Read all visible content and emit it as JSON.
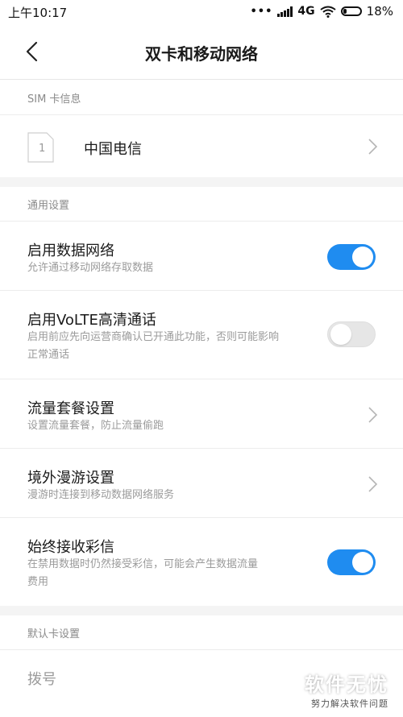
{
  "status_bar": {
    "time": "上午10:17",
    "dots": "•••",
    "network": "4G",
    "battery": "18%"
  },
  "header": {
    "title": "双卡和移动网络",
    "back_icon": "chevron-left-icon"
  },
  "sim_section": {
    "header": "SIM 卡信息",
    "sim": {
      "slot": "1",
      "name": "中国电信"
    }
  },
  "general_section": {
    "header": "通用设置",
    "items": [
      {
        "title": "启用数据网络",
        "subtitle": "允许通过移动网络存取数据",
        "control": "toggle",
        "state": "on"
      },
      {
        "title": "启用VoLTE高清通话",
        "subtitle": "启用前应先向运营商确认已开通此功能，否则可能影响正常通话",
        "control": "toggle",
        "state": "off"
      },
      {
        "title": "流量套餐设置",
        "subtitle": "设置流量套餐，防止流量偷跑",
        "control": "chevron"
      },
      {
        "title": "境外漫游设置",
        "subtitle": "漫游时连接到移动数据网络服务",
        "control": "chevron"
      },
      {
        "title": "始终接收彩信",
        "subtitle": "在禁用数据时仍然接受彩信，可能会产生数据流量费用",
        "control": "toggle",
        "state": "on"
      }
    ]
  },
  "default_section": {
    "header": "默认卡设置",
    "items": [
      {
        "title": "拨号"
      }
    ]
  },
  "watermark": {
    "brand": "软件无忧",
    "tagline": "努力解决软件问题"
  },
  "colors": {
    "accent": "#1f8cf0",
    "toggle_off": "#e6e6e6",
    "section_bg": "#f4f4f4"
  }
}
